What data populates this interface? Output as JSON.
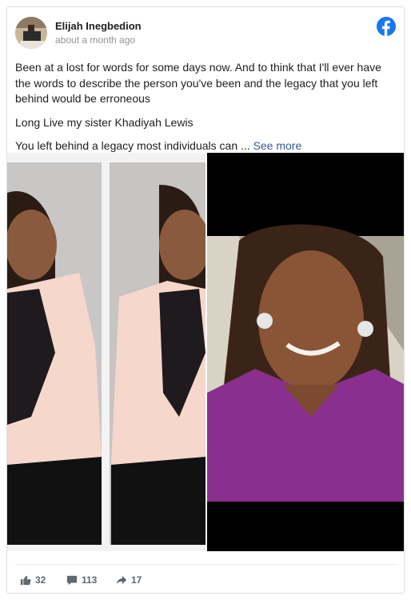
{
  "post": {
    "author": "Elijah Inegbedion",
    "timestamp": "about a month ago",
    "paragraphs": [
      "Been at a lost for words for some days now. And to think that I'll ever have the words to describe the person you've been and the legacy that you left behind would be erroneous",
      "Long Live my sister Khadiyah Lewis"
    ],
    "truncated_text": "You left behind a legacy most individuals can ... ",
    "see_more_label": "See more"
  },
  "engagement": {
    "likes": "32",
    "comments": "113",
    "shares": "17"
  },
  "icons": {
    "brand": "facebook-icon",
    "like": "thumbs-up-icon",
    "comment": "comment-icon",
    "share": "share-arrow-icon"
  },
  "colors": {
    "facebook_blue": "#1877f2",
    "link": "#365899",
    "meta_text": "#90949c",
    "count_text": "#606770"
  }
}
